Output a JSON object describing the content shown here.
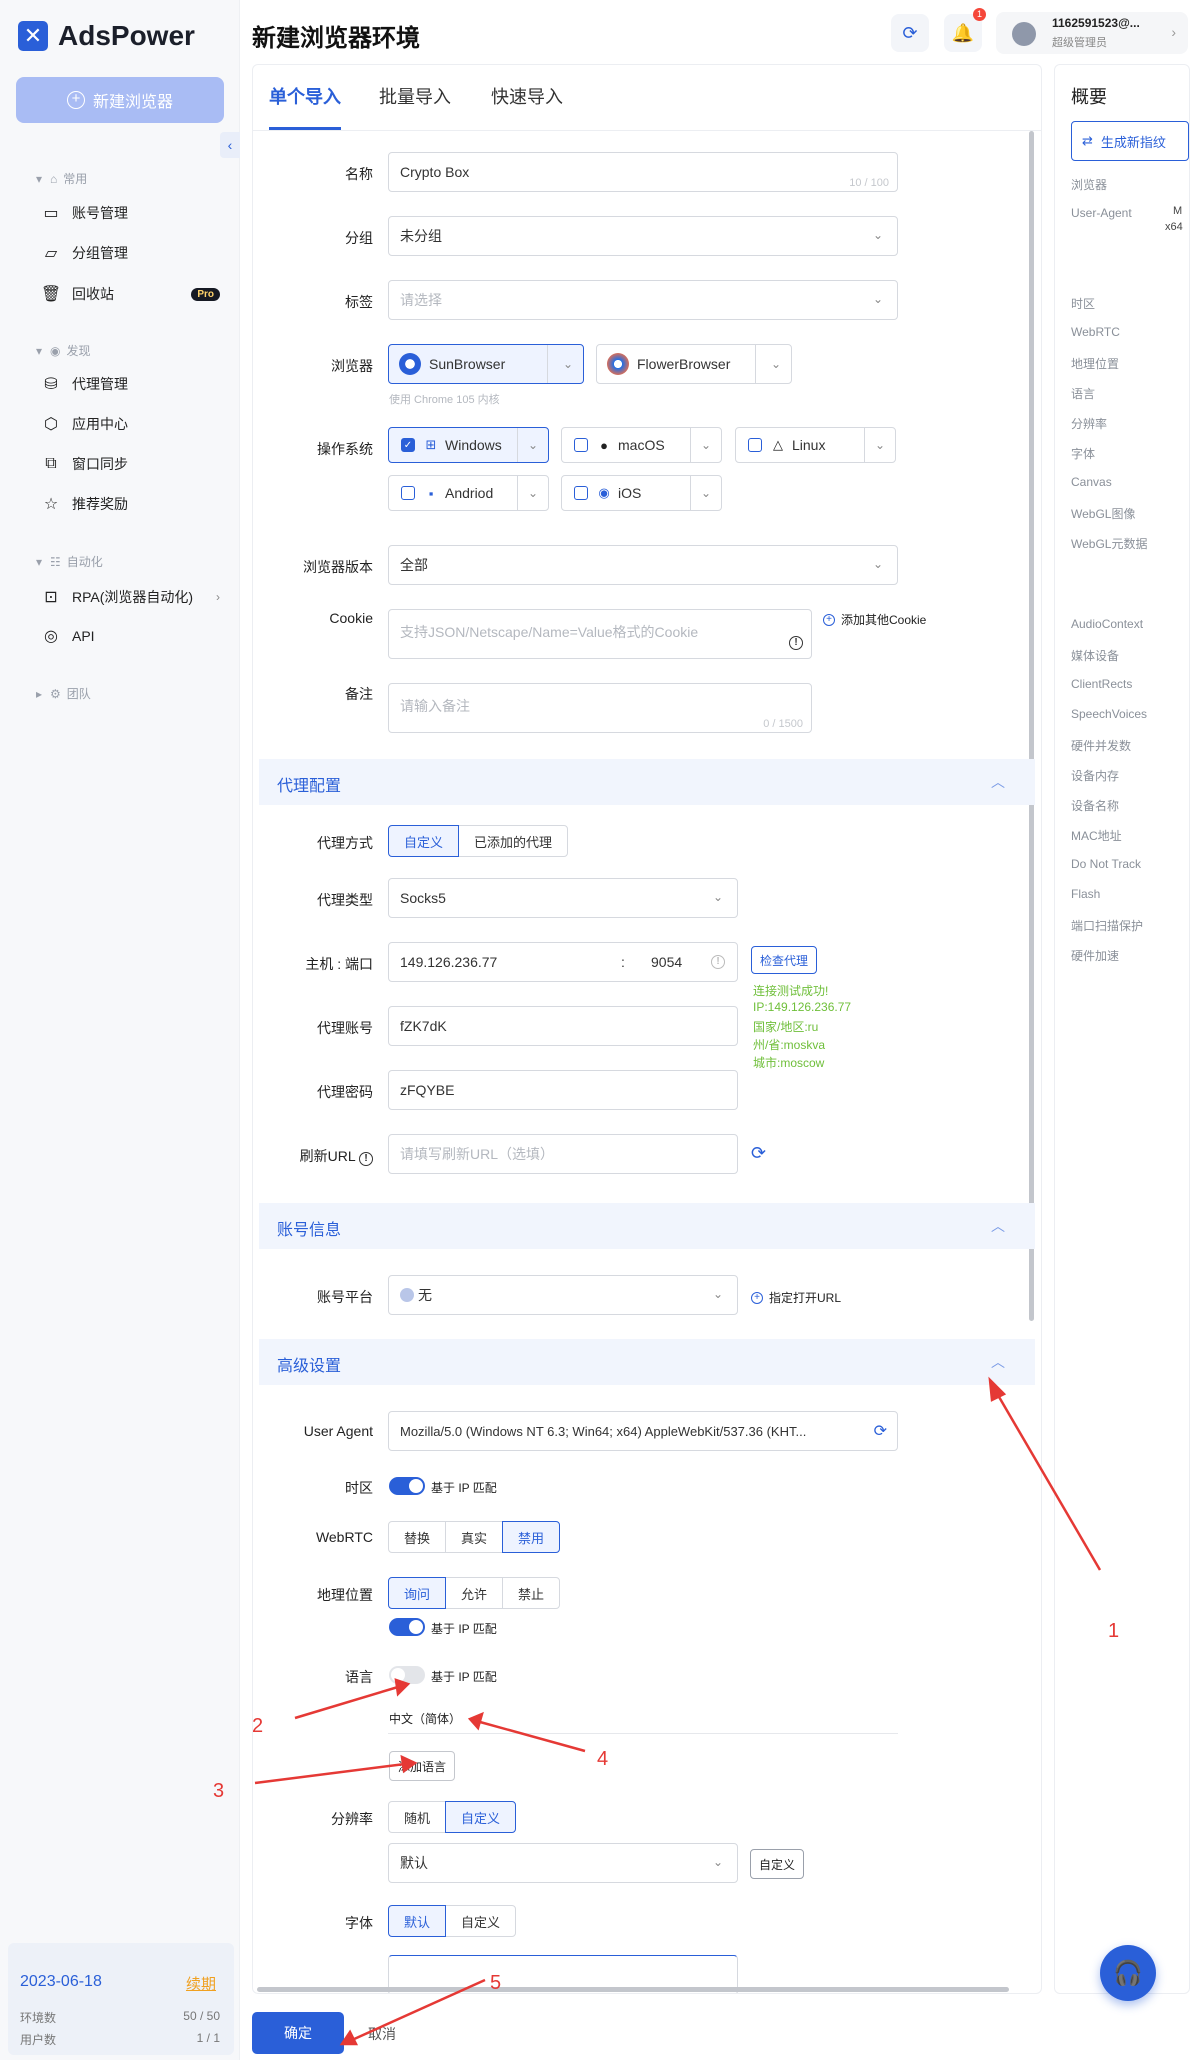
{
  "colors": {
    "accent": "#2a5fd8",
    "success": "#6fbf3a",
    "annotation": "#e53935"
  },
  "app": {
    "logo_text": "AdsPower",
    "page_title": "新建浏览器环境"
  },
  "sidebar": {
    "new_browser_label": "新建浏览器",
    "groups": {
      "common": "常用",
      "discover": "发现",
      "automation": "自动化",
      "team": "团队"
    },
    "items": [
      {
        "label": "账号管理",
        "icon": "user-manage-icon"
      },
      {
        "label": "分组管理",
        "icon": "folder-icon"
      },
      {
        "label": "回收站",
        "icon": "trash-icon",
        "badge": "Pro"
      },
      {
        "label": "代理管理",
        "icon": "proxy-icon"
      },
      {
        "label": "应用中心",
        "icon": "app-center-icon"
      },
      {
        "label": "窗口同步",
        "icon": "window-sync-icon"
      },
      {
        "label": "推荐奖励",
        "icon": "star-icon"
      },
      {
        "label": "RPA(浏览器自动化)",
        "icon": "robot-icon"
      },
      {
        "label": "API",
        "icon": "api-icon"
      }
    ],
    "footer": {
      "date": "2023-06-18",
      "renew": "续期",
      "env_label": "环境数",
      "env_value": "50 / 50",
      "users_label": "用户数",
      "users_value": "1 / 1"
    }
  },
  "header": {
    "notification_count": "1",
    "user_name": "1162591523@...",
    "user_role": "超级管理员"
  },
  "tabs": [
    "单个导入",
    "批量导入",
    "快速导入"
  ],
  "form": {
    "name_label": "名称",
    "name_value": "Crypto Box",
    "name_counter": "10 / 100",
    "group_label": "分组",
    "group_value": "未分组",
    "tag_label": "标签",
    "tag_placeholder": "请选择",
    "browser_label": "浏览器",
    "browser_options": [
      "SunBrowser",
      "FlowerBrowser"
    ],
    "browser_hint": "使用 Chrome 105 内核",
    "os_label": "操作系统",
    "os_options": [
      "Windows",
      "macOS",
      "Linux",
      "Andriod",
      "iOS"
    ],
    "browser_version_label": "浏览器版本",
    "browser_version_value": "全部",
    "cookie_label": "Cookie",
    "cookie_placeholder": "支持JSON/Netscape/Name=Value格式的Cookie",
    "cookie_add": "添加其他Cookie",
    "remark_label": "备注",
    "remark_placeholder": "请输入备注",
    "remark_counter": "0 / 1500"
  },
  "proxy": {
    "section_title": "代理配置",
    "method_label": "代理方式",
    "method_options": [
      "自定义",
      "已添加的代理"
    ],
    "type_label": "代理类型",
    "type_value": "Socks5",
    "host_label": "主机 : 端口",
    "host_value": "149.126.236.77",
    "port_separator": ":",
    "port_value": "9054",
    "check_btn": "检查代理",
    "check_result": [
      "连接测试成功!",
      "IP:149.126.236.77",
      "国家/地区:ru",
      "州/省:moskva",
      "城市:moscow"
    ],
    "account_label": "代理账号",
    "account_value": "fZK7dK",
    "password_label": "代理密码",
    "password_value": "zFQYBE",
    "refresh_label": "刷新URL",
    "refresh_placeholder": "请填写刷新URL（选填）"
  },
  "account_info": {
    "section_title": "账号信息",
    "platform_label": "账号平台",
    "platform_value": "无",
    "open_url": "指定打开URL"
  },
  "advanced": {
    "section_title": "高级设置",
    "ua_label": "User Agent",
    "ua_value": "Mozilla/5.0 (Windows NT 6.3; Win64; x64) AppleWebKit/537.36 (KHT...",
    "timezone_label": "时区",
    "ip_match": "基于 IP 匹配",
    "webrtc_label": "WebRTC",
    "webrtc_options": [
      "替换",
      "真实",
      "禁用"
    ],
    "geo_label": "地理位置",
    "geo_options": [
      "询问",
      "允许",
      "禁止"
    ],
    "lang_label": "语言",
    "lang_value": "中文（简体）",
    "add_lang": "添加语言",
    "res_label": "分辨率",
    "res_options": [
      "随机",
      "自定义"
    ],
    "res_value": "默认",
    "res_custom_btn": "自定义",
    "font_label": "字体",
    "font_options": [
      "默认",
      "自定义"
    ]
  },
  "summary": {
    "title": "概要",
    "gen_btn": "生成新指纹",
    "items": [
      "浏览器",
      "User-Agent",
      "时区",
      "WebRTC",
      "地理位置",
      "语言",
      "分辨率",
      "字体",
      "Canvas",
      "WebGL图像",
      "WebGL元数据",
      "AudioContext",
      "媒体设备",
      "ClientRects",
      "SpeechVoices",
      "硬件并发数",
      "设备内存",
      "设备名称",
      "MAC地址",
      "Do Not Track",
      "Flash",
      "端口扫描保护",
      "硬件加速"
    ],
    "ua_value_1": "M",
    "ua_value_2": "x64"
  },
  "footer": {
    "confirm": "确定",
    "cancel": "取消"
  },
  "annotations": [
    "1",
    "2",
    "3",
    "4",
    "5"
  ]
}
